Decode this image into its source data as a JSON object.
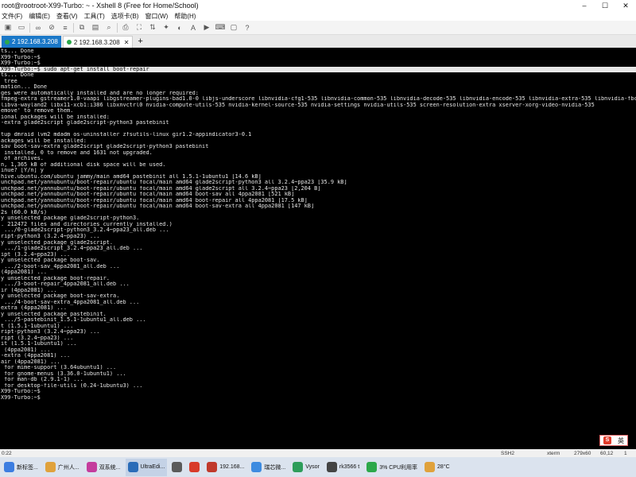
{
  "window": {
    "title": "root@rootroot-X99-Turbo: ~ - Xshell 8 (Free for Home/School)",
    "minimize": "–",
    "maximize": "☐",
    "close": "✕"
  },
  "menu": [
    "文件(F)",
    "编辑(E)",
    "查看(V)",
    "工具(T)",
    "选项卡(B)",
    "窗口(W)",
    "帮助(H)"
  ],
  "tabs": [
    {
      "label": "2 192.168.3.208",
      "active": true
    },
    {
      "label": "2 192.168.3.208",
      "active": false
    }
  ],
  "tab_add": "+",
  "terminal": {
    "lines": [
      "ts... Done",
      "X99-Turbo:~$",
      "X99-Turbo:~$",
      "X99-Turbo:~$ sudo apt-get install boot-repair",
      "ts... Done",
      " tree",
      "mation... Done",
      "ges were automatically installed and are no longer required:",
      "fmpeg-extra gstreamer1.0-vaapi libgstreamer-plugins-bad1.0-0 libjs-underscore libnvidia-cfg1-535 libnvidia-common-535 libnvidia-decode-535 libnvidia-encode-535 libnvidia-extra-535 libnvidia-fbc1",
      "libva-wayland2 libx11-xcb1:i386 libxnvctrl0 nvidia-compute-utils-535 nvidia-kernel-source-535 nvidia-settings nvidia-utils-535 screen-resolution-extra xserver-xorg-video-nvidia-535",
      "emove' to remove them.",
      "ional packages will be installed:",
      "-extra glade2script glade2script-python3 pastebinit",
      "",
      "tup dmraid lvm2 mdadm os-uninstaller zfsutils-linux gir1.2-appindicator3-0.1",
      "ackages will be installed:",
      "sav boot-sav-extra glade2script glade2script-python3 pastebinit",
      " installed, 0 to remove and 1631 not upgraded.",
      " of archives.",
      "n, 1,365 kB of additional disk space will be used.",
      "inue? [Y/n] y",
      "hive.ubuntu.com/ubuntu jammy/main amd64 pastebinit all 1.5.1-1ubuntu1 [14.6 kB]",
      "unchpad.net/yannubuntu/boot-repair/ubuntu focal/main amd64 glade2script-python3 all 3.2.4~ppa23 [35.9 kB]",
      "unchpad.net/yannubuntu/boot-repair/ubuntu focal/main amd64 glade2script all 3.2.4~ppa23 [2,204 B]",
      "unchpad.net/yannubuntu/boot-repair/ubuntu focal/main amd64 boot-sav all 4ppa2081 [521 kB]",
      "unchpad.net/yannubuntu/boot-repair/ubuntu focal/main amd64 boot-repair all 4ppa2081 [17.5 kB]",
      "unchpad.net/yannubuntu/boot-repair/ubuntu focal/main amd64 boot-sav-extra all 4ppa2081 [147 kB]",
      "2s (60.0 kB/s)",
      "y unselected package glade2script-python3.",
      ". 212472 files and directories currently installed.)",
      " .../0-glade2script-python3_3.2.4~ppa23_all.deb ...",
      "ript-python3 (3.2.4~ppa23) ...",
      "y unselected package glade2script.",
      " .../1-glade2script_3.2.4~ppa23_all.deb ...",
      "ipt (3.2.4~ppa23) ...",
      "y unselected package boot-sav.",
      " .../2-boot-sav_4ppa2081_all.deb ...",
      "(4ppa2081) ...",
      "y unselected package boot-repair.",
      " .../3-boot-repair_4ppa2081_all.deb ...",
      "ir (4ppa2081) ...",
      "y unselected package boot-sav-extra.",
      " .../4-boot-sav-extra_4ppa2081_all.deb ...",
      "extra (4ppa2081) ...",
      "y unselected package pastebinit.",
      " .../5-pastebinit_1.5.1-1ubuntu1_all.deb ...",
      "t (1.5.1-1ubuntu1) ...",
      "ript-python3 (3.2.4~ppa23) ...",
      "ript (3.2.4~ppa23) ...",
      "it (1.5.1-1ubuntu1) ...",
      " (4ppa2081) ...",
      "-extra (4ppa2081) ...",
      "air (4ppa2081) ...",
      " for mime-support (3.64ubuntu1) ...",
      " for gnome-menus (3.36.0-1ubuntu1) ...",
      " for man-db (2.9.1-1) ...",
      " for desktop-file-utils (0.24-1ubuntu3) ...",
      "X99-Turbo:~$",
      "X99-Turbo:~$"
    ],
    "highlight_index": 3,
    "cursor_index": 60
  },
  "statusbar": {
    "left": "0:22",
    "protocol": "SSH2",
    "term": "xterm",
    "size": "279x60",
    "pos": "60,12",
    "sessions": "1"
  },
  "ime": {
    "label": "英"
  },
  "taskbar": [
    {
      "label": "新标签...",
      "color": "#3c7de0"
    },
    {
      "label": "广州人...",
      "color": "#e0a23c"
    },
    {
      "label": "双系统...",
      "color": "#c43c9d"
    },
    {
      "label": "UltraEdi...",
      "color": "#2a6cb8"
    },
    {
      "label": "",
      "color": "#5a5a5a"
    },
    {
      "label": "",
      "color": "#d83b2a"
    },
    {
      "label": "192.168...",
      "color": "#c0392b"
    },
    {
      "label": "瑞芯微...",
      "color": "#3d8be0"
    },
    {
      "label": "Vysor",
      "color": "#2d9d5a"
    },
    {
      "label": "rk3566 t",
      "color": "#444444"
    },
    {
      "label": "3% CPU利用率",
      "color": "#2ca84a"
    },
    {
      "label": "28°C",
      "color": "#e0a23c"
    }
  ],
  "colors": {
    "terminal_bg": "#000000",
    "terminal_fg": "#e6e6e6",
    "cursor": "#25d23c",
    "active_tab": "#1a78c8"
  }
}
